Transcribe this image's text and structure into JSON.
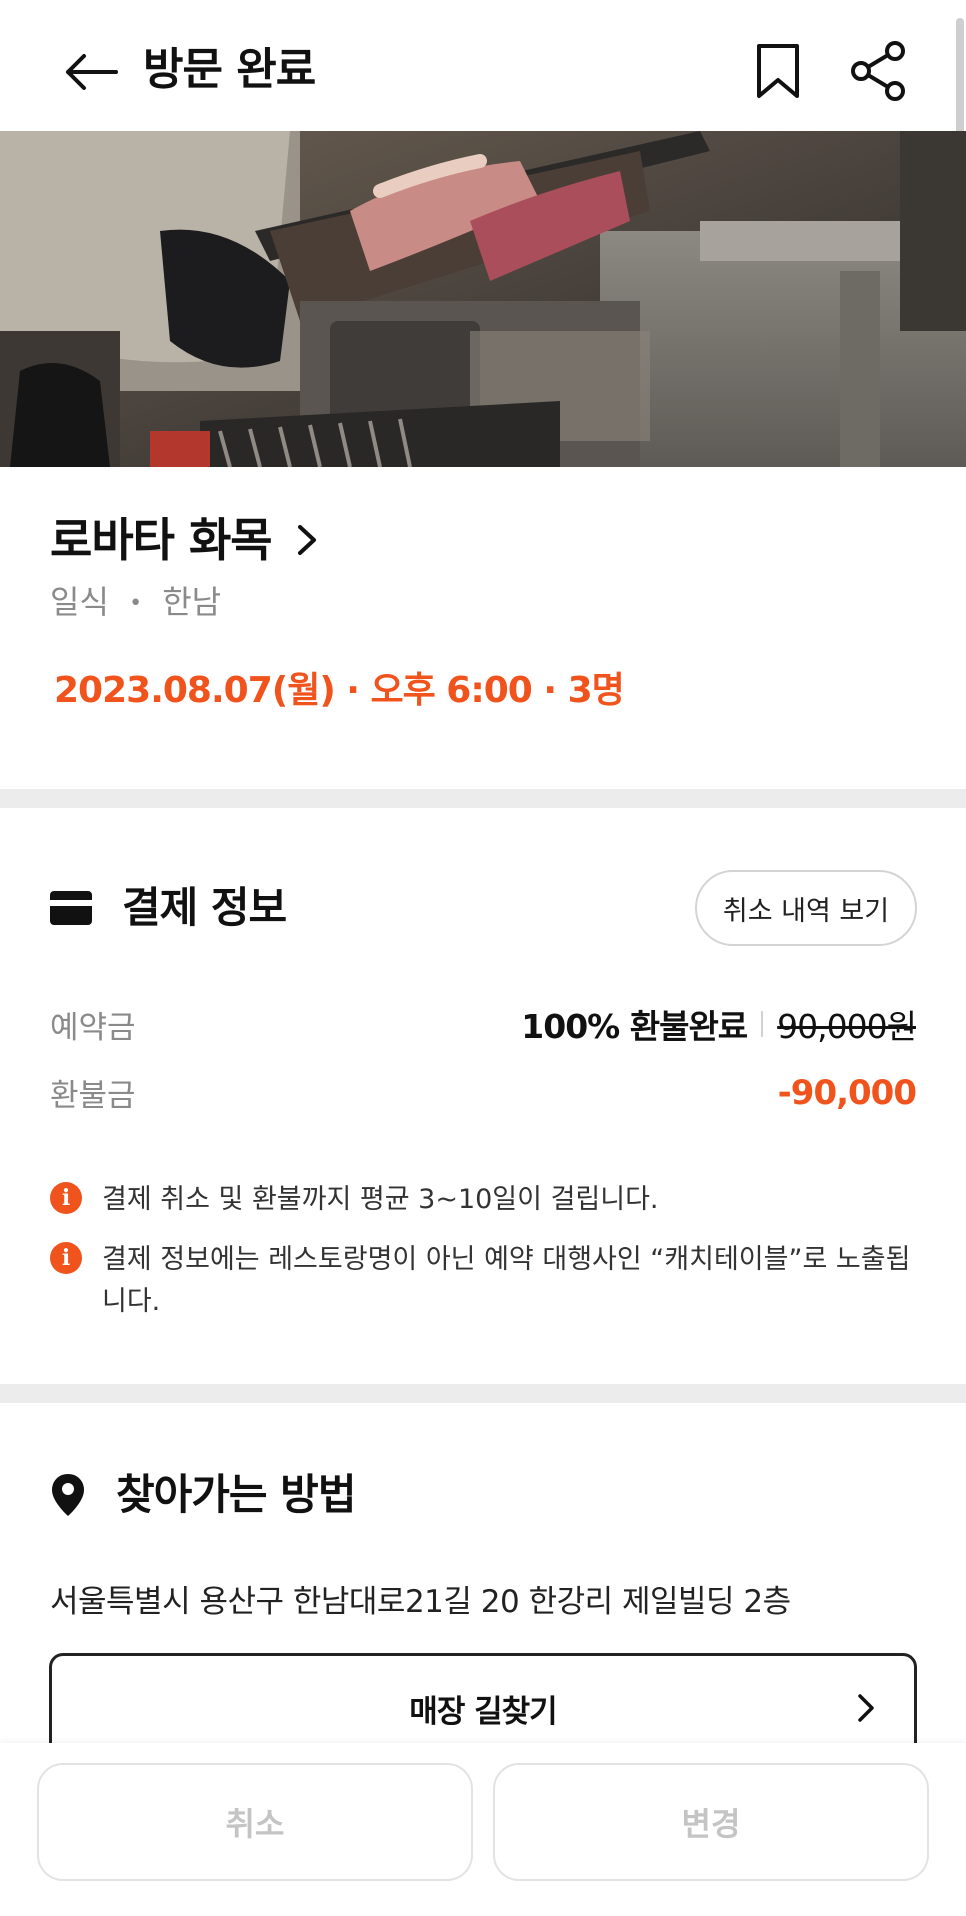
{
  "header": {
    "title": "방문 완료"
  },
  "restaurant": {
    "name": "로바타 화목",
    "category": "일식",
    "area": "한남",
    "separator": "•",
    "reservation": "2023.08.07(월) · 오후 6:00 · 3명"
  },
  "payment": {
    "section_title": "결제 정보",
    "cancel_history_label": "취소 내역 보기",
    "deposit_label": "예약금",
    "deposit_status": "100% 환불완료",
    "deposit_amount": "90,000원",
    "refund_label": "환불금",
    "refund_amount": "-90,000",
    "notices": [
      "결제 취소 및 환불까지 평균 3~10일이 걸립니다.",
      "결제 정보에는 레스토랑명이 아닌 예약 대행사인 “캐치테이블”로 노출됩니다."
    ],
    "notice_icon": "i"
  },
  "directions": {
    "section_title": "찾아가는 방법",
    "address": "서울특별시 용산구 한남대로21길 20 한강리 제일빌딩 2층",
    "route_button_label": "매장 길찾기"
  },
  "bottom_bar": {
    "cancel_label": "취소",
    "change_label": "변경"
  },
  "colors": {
    "accent": "#f0531c",
    "muted_text": "#8a8a8a",
    "divider": "#ececec",
    "disabled_text": "#c4c4c4"
  },
  "icons": {
    "back": "arrow-left-icon",
    "bookmark": "bookmark-icon",
    "share": "share-icon",
    "payment": "credit-card-icon",
    "location": "map-pin-icon",
    "info": "info-icon",
    "chevron": "chevron-right-icon"
  }
}
